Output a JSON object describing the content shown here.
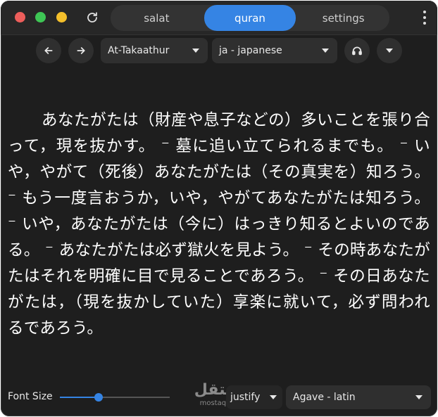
{
  "tabs": [
    {
      "label": "salat",
      "active": false
    },
    {
      "label": "quran",
      "active": true
    },
    {
      "label": "settings",
      "active": false
    }
  ],
  "toolbar": {
    "surah": "At-Takaathur",
    "language": "ja - japanese"
  },
  "verse_text": "あなたがたは（財産や息子などの）多いことを張り合って，現を抜かす。 ⁻ 墓に追い立てられるまでも。 ⁻ いや，やがて（死後）あなたがたは（その真実を）知ろう。 ⁻ もう一度言おうか，いや，やがてあなたがたは知ろう。 ⁻ いや，あなたがたは（今に）はっきり知るとよいのである。 ⁻ あなたがたは必ず獄火を見よう。 ⁻ その時あなたがたはそれを明確に目で見ることであろう。 ⁻ その日あなたがたは，（現を抜かしていた）享楽に就いて，必ず問われるであろう。",
  "bottom": {
    "font_size_label": "Font Size",
    "font_size_level": 0.35,
    "alignment": "justify",
    "font_family": "Agave - latin"
  },
  "watermark": {
    "main": "مستقل",
    "sub": "mostaql.com"
  },
  "colors": {
    "accent": "#3584e4",
    "background": "#1e1e1e",
    "close": "#ed5e5b",
    "maximize": "#3ec655",
    "minimize": "#f4bf2b"
  },
  "icons": [
    "refresh-icon",
    "arrow-left-icon",
    "arrow-right-icon",
    "headphones-icon",
    "chevron-down-icon",
    "kebab-menu-icon"
  ]
}
